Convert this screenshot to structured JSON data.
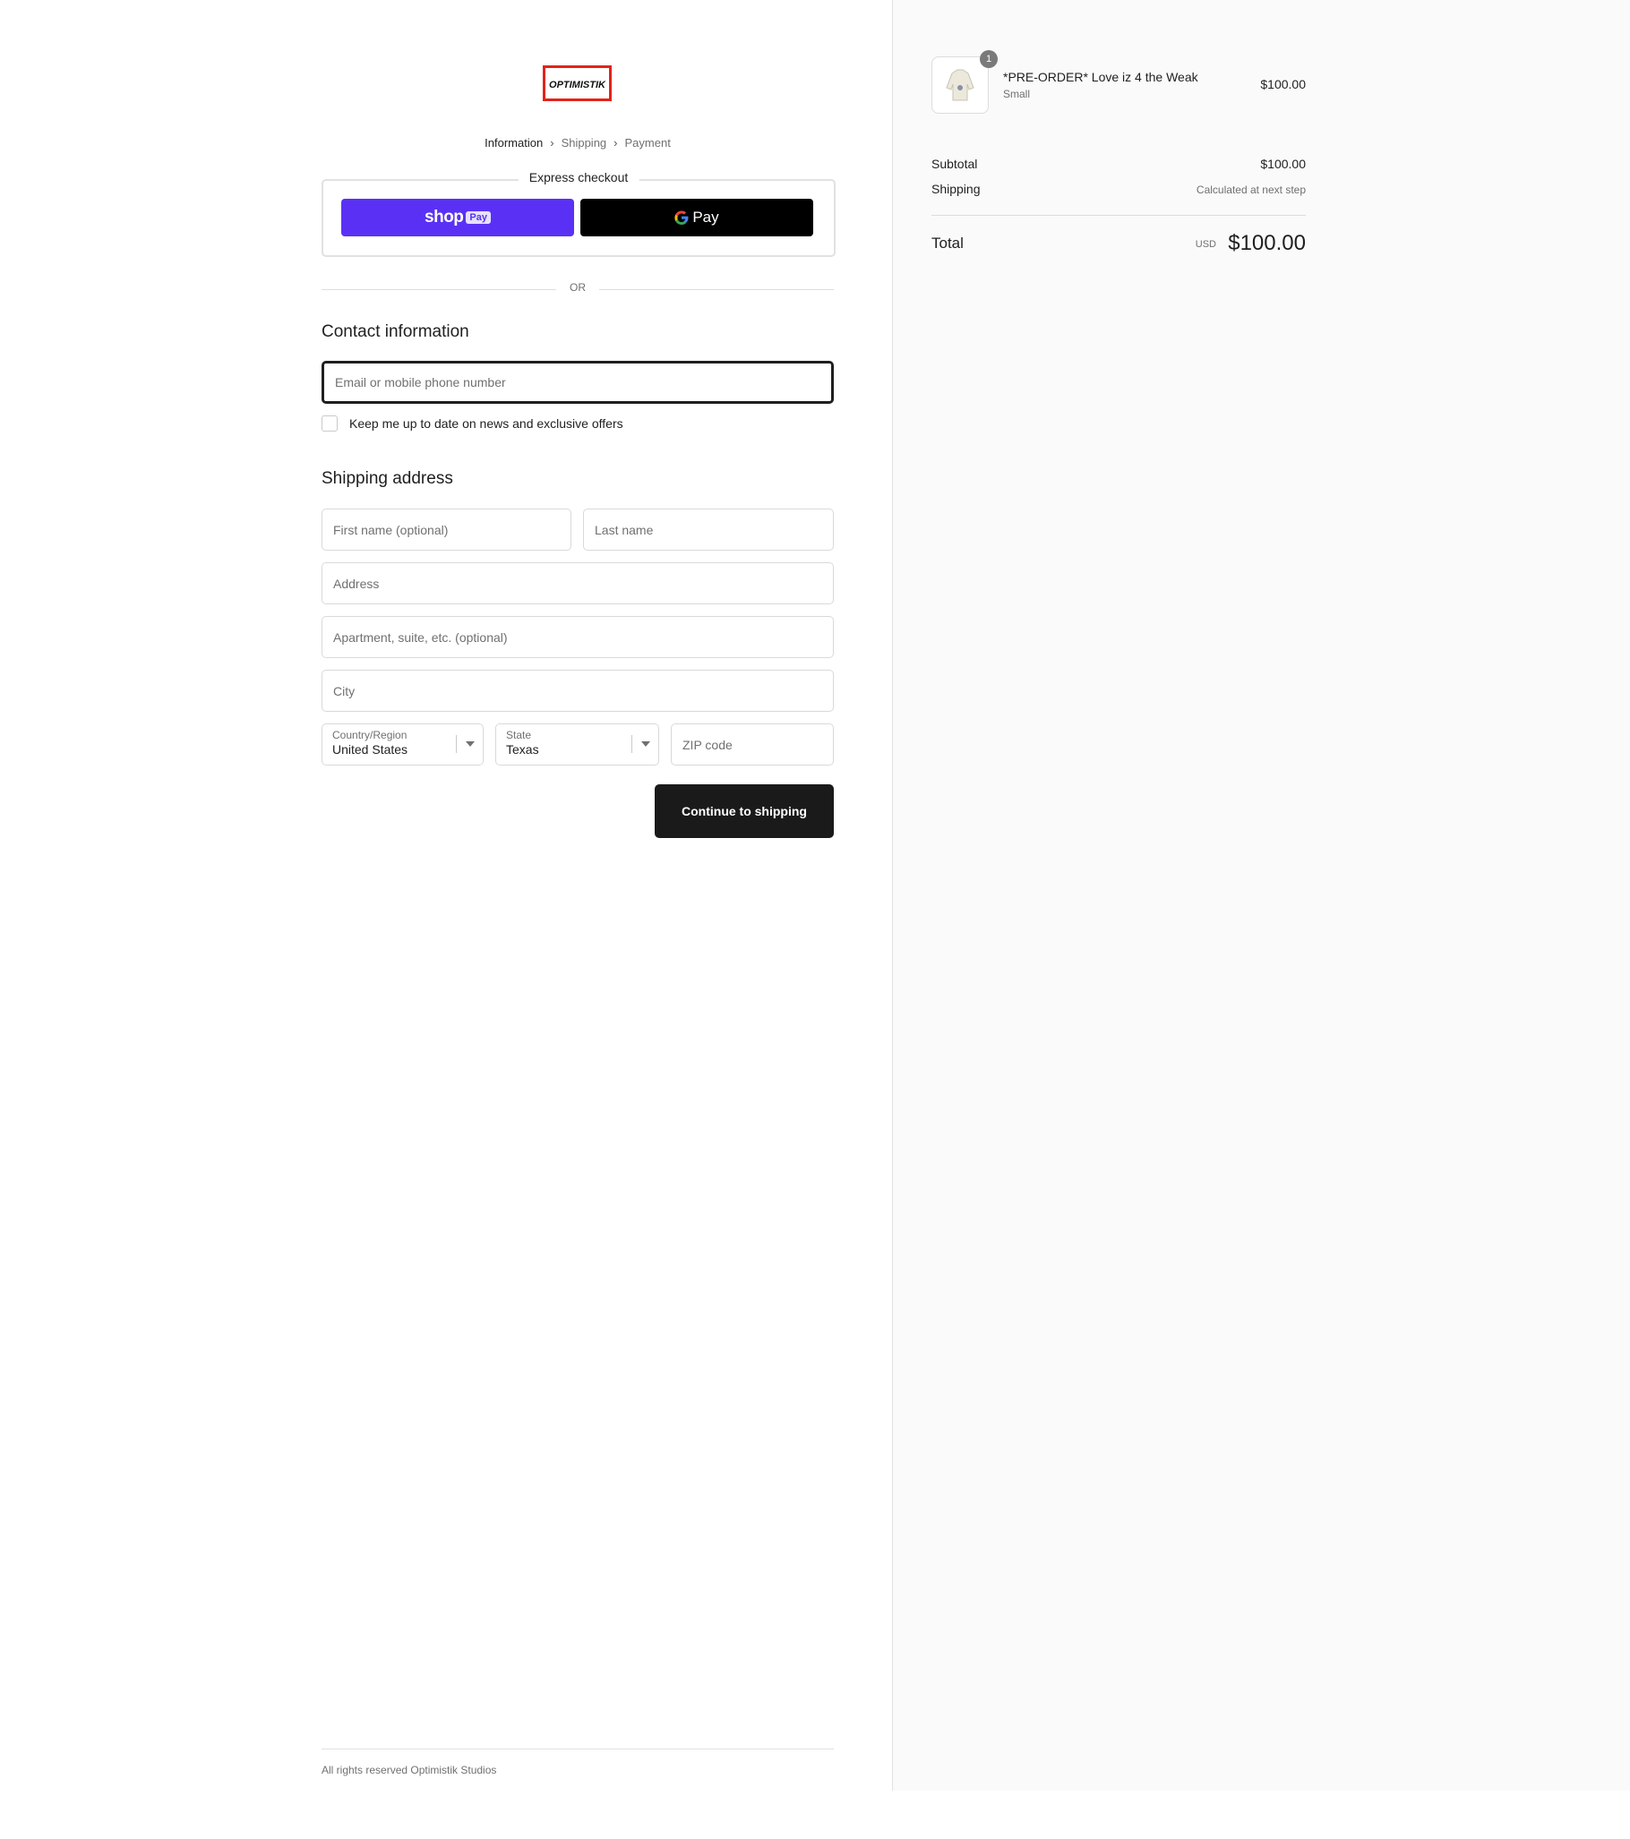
{
  "brand": {
    "logo_text": "OPTIMISTIK",
    "accent_color": "#e2231a"
  },
  "breadcrumb": {
    "step1": "Information",
    "step2": "Shipping",
    "step3": "Payment"
  },
  "express": {
    "legend": "Express checkout",
    "shop_pay_word": "shop",
    "shop_pay_badge": "Pay",
    "shop_pay_color": "#5a31f4",
    "gpay_g": "G",
    "gpay_word": "Pay"
  },
  "divider": {
    "or_text": "OR"
  },
  "contact": {
    "title": "Contact information",
    "email_placeholder": "Email or mobile phone number",
    "newsletter_label": "Keep me up to date on news and exclusive offers"
  },
  "shipping": {
    "title": "Shipping address",
    "first_name_placeholder": "First name (optional)",
    "last_name_placeholder": "Last name",
    "address_placeholder": "Address",
    "apartment_placeholder": "Apartment, suite, etc. (optional)",
    "city_placeholder": "City",
    "country_label": "Country/Region",
    "country_value": "United States",
    "state_label": "State",
    "state_value": "Texas",
    "zip_placeholder": "ZIP code",
    "continue_label": "Continue to shipping"
  },
  "footer": {
    "text": "All rights reserved Optimistik Studios"
  },
  "order": {
    "quantity": "1",
    "product_name": "*PRE-ORDER* Love iz 4 the Weak",
    "variant": "Small",
    "price": "$100.00",
    "subtotal_label": "Subtotal",
    "subtotal_value": "$100.00",
    "shipping_label": "Shipping",
    "shipping_value": "Calculated at next step",
    "total_label": "Total",
    "currency": "USD",
    "total_value": "$100.00"
  }
}
